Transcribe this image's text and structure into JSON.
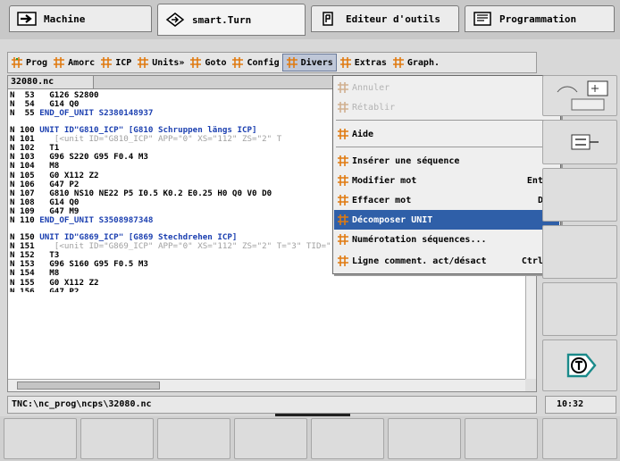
{
  "mode_tabs": [
    {
      "label": "Machine",
      "icon": "arrow-into-box-icon"
    },
    {
      "label": "smart.Turn",
      "icon": "diamond-arrow-icon"
    },
    {
      "label": "Editeur d'outils",
      "icon": "tool-editor-icon"
    },
    {
      "label": "Programmation",
      "icon": "monitor-icon"
    }
  ],
  "menu_bar": {
    "items": [
      "Prog",
      "Amorc",
      "ICP",
      "Units»",
      "Goto",
      "Config",
      "Divers",
      "Extras",
      "Graph."
    ]
  },
  "editor": {
    "file_tab": "32080.nc",
    "lines": [
      {
        "n": "N  53",
        "code": "   G126 S2800",
        "cls": ""
      },
      {
        "n": "N  54",
        "code": "   G14 Q0",
        "cls": ""
      },
      {
        "n": "N  55",
        "code": " END_OF_UNIT S2380148937",
        "cls": "blue"
      },
      {
        "gap": true
      },
      {
        "n": "N 100",
        "code": " UNIT ID\"G810_ICP\" [G810 Schruppen längs ICP]",
        "cls": "blue"
      },
      {
        "n": "N 101",
        "code": "    [<unit ID=\"G810_ICP\" APP=\"0\" XS=\"112\" ZS=\"2\" T",
        "cls": "grey"
      },
      {
        "n": "N 102",
        "code": "   T1",
        "cls": ""
      },
      {
        "n": "N 103",
        "code": "   G96 S220 G95 F0.4 M3",
        "cls": ""
      },
      {
        "n": "N 104",
        "code": "   M8",
        "cls": ""
      },
      {
        "n": "N 105",
        "code": "   G0 X112 Z2",
        "cls": ""
      },
      {
        "n": "N 106",
        "code": "   G47 P2",
        "cls": ""
      },
      {
        "n": "N 107",
        "code": "   G810 NS10 NE22 P5 I0.5 K0.2 E0.25 H0 Q0 V0 D0",
        "cls": ""
      },
      {
        "n": "N 108",
        "code": "   G14 Q0",
        "cls": ""
      },
      {
        "n": "N 109",
        "code": "   G47 M9",
        "cls": ""
      },
      {
        "n": "N 110",
        "code": " END_OF_UNIT S3508987348",
        "cls": "blue"
      },
      {
        "gap": true
      },
      {
        "n": "N 150",
        "code": " UNIT ID\"G869_ICP\" [G869 Stechdrehen ICP]",
        "cls": "blue"
      },
      {
        "n": "N 151",
        "code": "    [<unit ID=\"G869_ICP\" APP=\"0\" XS=\"112\" ZS=\"2\" T=\"3\" TID=\"\" F=\"0.5\" S=\"160\" FK=\"",
        "cls": "grey"
      },
      {
        "n": "N 152",
        "code": "   T3",
        "cls": ""
      },
      {
        "n": "N 153",
        "code": "   G96 S160 G95 F0.5 M3",
        "cls": ""
      },
      {
        "n": "N 154",
        "code": "   M8",
        "cls": ""
      },
      {
        "n": "N 155",
        "code": "   G0 X112 Z2",
        "cls": ""
      },
      {
        "n": "N 156",
        "code": "   G47 P2",
        "cls": "cut"
      }
    ]
  },
  "dropdown": {
    "items": [
      {
        "label": "Annuler",
        "key": "",
        "state": "disabled",
        "arrow": false
      },
      {
        "label": "Rétablir",
        "key": "",
        "state": "disabled",
        "arrow": false
      },
      {
        "label": "Aide",
        "key": "",
        "state": "normal",
        "arrow": false
      },
      {
        "label": "Insérer une séquence",
        "key": "",
        "state": "normal",
        "arrow": true
      },
      {
        "label": "Modifier mot",
        "key": "Enter",
        "state": "normal",
        "arrow": false
      },
      {
        "label": "Effacer mot",
        "key": "Del",
        "state": "normal",
        "arrow": false
      },
      {
        "label": "Décomposer UNIT",
        "key": "",
        "state": "selected",
        "arrow": false
      },
      {
        "label": "Numérotation séquences...",
        "key": "",
        "state": "normal",
        "arrow": false
      },
      {
        "label": "Ligne comment. act/désact",
        "key": "Ctrl+K",
        "state": "normal",
        "arrow": false
      }
    ]
  },
  "status": {
    "path": "TNC:\\nc_prog\\ncps\\32080.nc",
    "time": "10:32"
  },
  "colors": {
    "accent": "#2f5fa8",
    "code_blue": "#1b3fb0",
    "menu_icon_orange": "#e07a10"
  }
}
